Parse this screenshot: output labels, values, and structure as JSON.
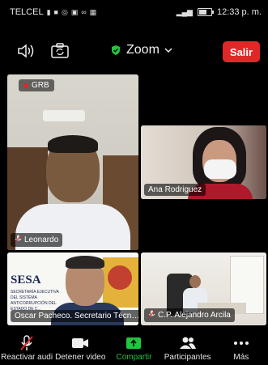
{
  "status_bar": {
    "carrier": "TELCEL",
    "time": "12:33 p. m.",
    "notification_icons": [
      "signal-bars-icon",
      "video-app-icon",
      "whatsapp-icon",
      "facebook-icon",
      "messenger-icon",
      "image-icon"
    ]
  },
  "toolbar": {
    "speaker_icon": "speaker-icon",
    "switch_camera_icon": "switch-camera-icon",
    "meeting_app_title": "Zoom",
    "leave_label": "Salir"
  },
  "participants": {
    "main": {
      "name": "Leonardo",
      "recording_label": "GRB"
    },
    "ana": {
      "name": "Ana Rodriguez"
    },
    "oscar": {
      "name": "Oscar Pacheco. Secretario Técn…",
      "background_text": "SESA",
      "background_subtext": "SECRETARÍA EJECUTIVA DEL SISTEMA ANTICORRUPCIÓN DEL ESTADO DE C..."
    },
    "alejandro": {
      "name": "C.P. Alejandro Arcila"
    }
  },
  "bottom_bar": {
    "unmute_label": "Reactivar audi",
    "stop_video_label": "Detener video",
    "share_label": "Compartir",
    "participants_label": "Participantes",
    "more_label": "Más"
  },
  "colors": {
    "leave_button": "#e02828",
    "share_green": "#23c43f",
    "recording_dot": "#e02828",
    "shield_green": "#23c43f"
  }
}
